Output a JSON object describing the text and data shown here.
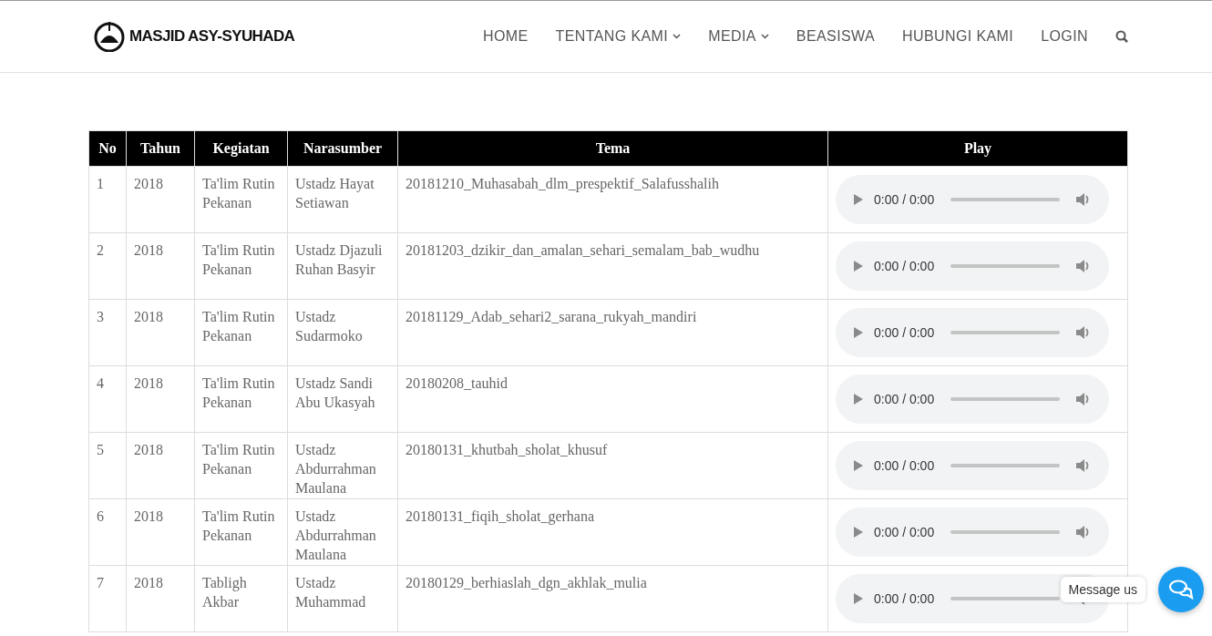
{
  "header": {
    "logo_text": "MASJID ASY-SYUHADA",
    "nav": [
      {
        "label": "HOME",
        "dropdown": false
      },
      {
        "label": "TENTANG KAMI",
        "dropdown": true
      },
      {
        "label": "MEDIA",
        "dropdown": true
      },
      {
        "label": "BEASISWA",
        "dropdown": false
      },
      {
        "label": "HUBUNGI KAMI",
        "dropdown": false
      },
      {
        "label": "LOGIN",
        "dropdown": false
      }
    ]
  },
  "table": {
    "columns": [
      "No",
      "Tahun",
      "Kegiatan",
      "Narasumber",
      "Tema",
      "Play"
    ],
    "rows": [
      {
        "no": "1",
        "tahun": "2018",
        "kegiatan": "Ta'lim Rutin Pekanan",
        "narasumber": "Ustadz Hayat Setiawan",
        "tema": "20181210_Muhasabah_dlm_prespektif_Salafusshalih",
        "player": {
          "time": "0:00 / 0:00"
        }
      },
      {
        "no": "2",
        "tahun": "2018",
        "kegiatan": "Ta'lim Rutin Pekanan",
        "narasumber": "Ustadz Djazuli Ruhan Basyir",
        "tema": "20181203_dzikir_dan_amalan_sehari_semalam_bab_wudhu",
        "player": {
          "time": "0:00 / 0:00"
        }
      },
      {
        "no": "3",
        "tahun": "2018",
        "kegiatan": "Ta'lim Rutin Pekanan",
        "narasumber": "Ustadz Sudarmoko",
        "tema": "20181129_Adab_sehari2_sarana_rukyah_mandiri",
        "player": {
          "time": "0:00 / 0:00"
        }
      },
      {
        "no": "4",
        "tahun": "2018",
        "kegiatan": "Ta'lim Rutin Pekanan",
        "narasumber": "Ustadz Sandi Abu Ukasyah",
        "tema": "20180208_tauhid",
        "player": {
          "time": "0:00 / 0:00"
        }
      },
      {
        "no": "5",
        "tahun": "2018",
        "kegiatan": "Ta'lim Rutin Pekanan",
        "narasumber": "Ustadz Abdurrahman Maulana",
        "tema": "20180131_khutbah_sholat_khusuf",
        "player": {
          "time": "0:00 / 0:00"
        }
      },
      {
        "no": "6",
        "tahun": "2018",
        "kegiatan": "Ta'lim Rutin Pekanan",
        "narasumber": "Ustadz Abdurrahman Maulana",
        "tema": "20180131_fiqih_sholat_gerhana",
        "player": {
          "time": "0:00 / 0:00"
        }
      },
      {
        "no": "7",
        "tahun": "2018",
        "kegiatan": "Tabligh Akbar",
        "narasumber": "Ustadz Muhammad",
        "tema": "20180129_berhiaslah_dgn_akhlak_mulia",
        "player": {
          "time": "0:00 / 0:00"
        }
      }
    ]
  },
  "chat_widget": {
    "tooltip": "Message us"
  }
}
